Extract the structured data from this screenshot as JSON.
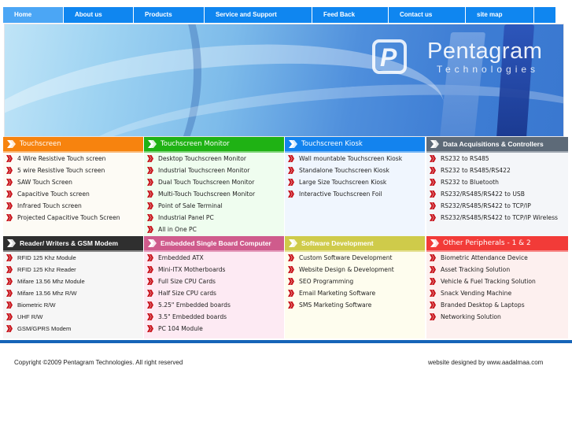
{
  "nav": {
    "items": [
      {
        "label": "Home"
      },
      {
        "label": "About us"
      },
      {
        "label": "Products"
      },
      {
        "label": "Service and Support"
      },
      {
        "label": "Feed Back"
      },
      {
        "label": "Contact us"
      },
      {
        "label": "site map"
      }
    ]
  },
  "banner": {
    "brand": "Pentagram",
    "sub": "Technologies",
    "logo_letter": "P"
  },
  "categories": [
    {
      "title": "Touchscreen",
      "color": "#f7830e",
      "bg": "#fdfbf5",
      "items": [
        "4 Wire Resistive Touch screen",
        "5 wire Resistive Touch screen",
        "SAW Touch Screen",
        "Capacitive Touch screen",
        "Infrared Touch screen",
        "Projected Capacitive Touch Screen"
      ]
    },
    {
      "title": "Touchscreen Monitor",
      "color": "#1fb214",
      "bg": "#effdef",
      "items": [
        "Desktop Touchscreen Monitor",
        "Industrial Touchscreen Monitor",
        "Dual Touch Touchscreen Monitor",
        "Multi-Touch Touchscreen Monitor",
        "Point of Sale Terminal",
        "Industrial Panel PC",
        "All in One PC"
      ]
    },
    {
      "title": "Touchscreen Kiosk",
      "color": "#1383ee",
      "bg": "#f0f6fe",
      "items": [
        "Wall mountable Touchscreen Kiosk",
        "Standalone Touchscreen Kiosk",
        "Large Size Touchscreen Kiosk",
        "Interactive Touchscreen Foil"
      ]
    },
    {
      "title": "Data Acquisitions & Controllers",
      "color": "#5d6a78",
      "bg": "#f4f6f9",
      "items": [
        "RS232 to RS485",
        "RS232 to RS485/RS422",
        "RS232 to Bluetooth",
        "RS232/RS485/RS422 to USB",
        "RS232/RS485/RS422 to TCP/IP",
        "RS232/RS485/RS422 to TCP/IP Wireless"
      ]
    },
    {
      "title": "Reader/ Writers & GSM Modem",
      "color": "#2f2f2f",
      "bg": "#f6f6f6",
      "items": [
        "RFID 125 Khz Module",
        "RFID 125 Khz Reader",
        "Mifare 13.56 Mhz Module",
        "Mifare 13.56 Mhz R/W",
        "Biometric R/W",
        "UHF R/W",
        "GSM/GPRS Modem"
      ]
    },
    {
      "title": "Embedded Single Board Computer",
      "color": "#cf5b8c",
      "bg": "#fdeaf3",
      "items": [
        "Embedded ATX",
        "Mini-ITX Motherboards",
        "Full Size CPU Cards",
        "Half Size CPU cards",
        "5.25\" Embedded boards",
        "3.5\" Embedded boards",
        "PC 104 Module"
      ]
    },
    {
      "title": "Software Development",
      "color": "#cfcb4a",
      "bg": "#fefdee",
      "items": [
        "Custom Software Development",
        "Website Design & Development",
        "SEO Programming",
        "Email Marketing Software",
        "SMS Marketing Software"
      ]
    },
    {
      "title": "Other Peripherals - 1 & 2",
      "color": "#f23b38",
      "bg": "#fdf0ef",
      "items": [
        "Biometric Attendance Device",
        "Asset Tracking Solution",
        "Vehicle & Fuel Tracking Solution",
        "Snack Vending Machine",
        "Branded Desktop & Laptops",
        "Networking Solution"
      ]
    }
  ],
  "footer": {
    "copyright": "Copyright ©2009 Pentagram Technologies. All right reserved",
    "designer": "website designed by www.aadalmaa.com"
  },
  "colors": {
    "nav_bg": "#0f86f0",
    "nav_active": "#4ba6f5",
    "bullet": "#c8141c",
    "footer_bar": "#1664b8"
  }
}
